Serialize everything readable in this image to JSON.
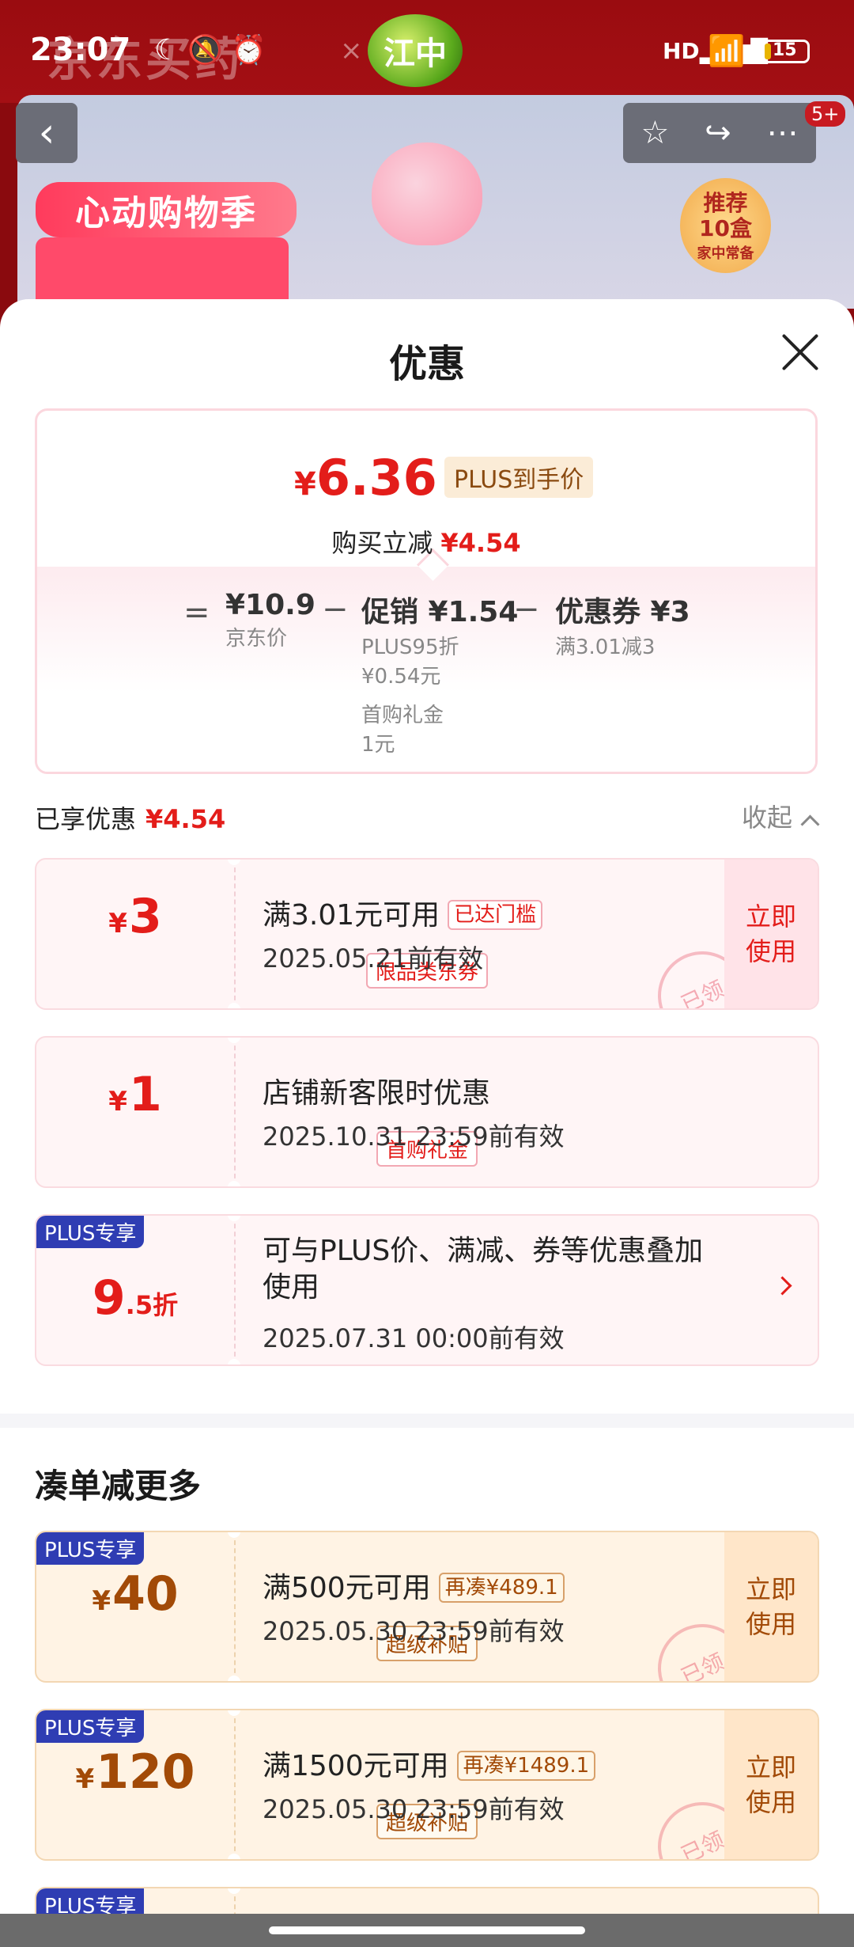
{
  "status": {
    "time": "23:07",
    "network": "HD",
    "battery": "15",
    "battery_level": 0.15
  },
  "background": {
    "brand": "京东买药",
    "brand_x": "×",
    "partner": "江中",
    "badge": "5+",
    "banner_title": "心动购物季",
    "medal": [
      "推荐",
      "10盒",
      "家中常备"
    ]
  },
  "sheet": {
    "title": "优惠",
    "summary": {
      "final_price_symbol": "¥",
      "final_price": "6.36",
      "plus_tag": "PLUS到手价",
      "reduce_label": "购买立减",
      "reduce_amount": "¥4.54",
      "equals": "=",
      "minus": "−",
      "jd_price": "¥10.9",
      "jd_price_label": "京东价",
      "promo_title": "促销 ¥1.54",
      "promo_line1": "PLUS95折",
      "promo_line2": "¥0.54元",
      "promo_line3": "首购礼金",
      "promo_line4": "1元",
      "coupon_title": "优惠券 ¥3",
      "coupon_line1": "满3.01减3"
    },
    "enjoyed_label": "已享优惠",
    "enjoyed_amount": "¥4.54",
    "collapse_label": "收起",
    "cards": [
      {
        "yen": "¥",
        "value": "3",
        "tag": "限品类东券",
        "desc": "满3.01元可用",
        "mini": "已达门槛",
        "date": "2025.05.21前有效",
        "use": [
          "立即",
          "使用"
        ],
        "stamp": "已领"
      },
      {
        "yen": "¥",
        "value": "1",
        "tag": "首购礼金",
        "desc": "店铺新客限时优惠",
        "date": "2025.10.31 23:59前有效"
      },
      {
        "corner": "PLUS专享",
        "value": "9",
        "value_small": ".5折",
        "desc_line1": "可与PLUS价、满减、券等优惠叠加",
        "desc_line2": "使用",
        "date": "2025.07.31 00:00前有效"
      }
    ],
    "section_title": "凑单减更多",
    "more_cards": [
      {
        "corner": "PLUS专享",
        "yen": "¥",
        "value": "40",
        "tag": "超级补贴",
        "desc": "满500元可用",
        "mini": "再凑¥489.1",
        "date": "2025.05.30 23:59前有效",
        "use": [
          "立即",
          "使用"
        ],
        "stamp": "已领"
      },
      {
        "corner": "PLUS专享",
        "yen": "¥",
        "value": "120",
        "tag": "超级补贴",
        "desc": "满1500元可用",
        "mini": "再凑¥1489.1",
        "date": "2025.05.30 23:59前有效",
        "use": [
          "立即",
          "使用"
        ],
        "stamp": "已领"
      },
      {
        "corner": "PLUS专享"
      }
    ]
  }
}
